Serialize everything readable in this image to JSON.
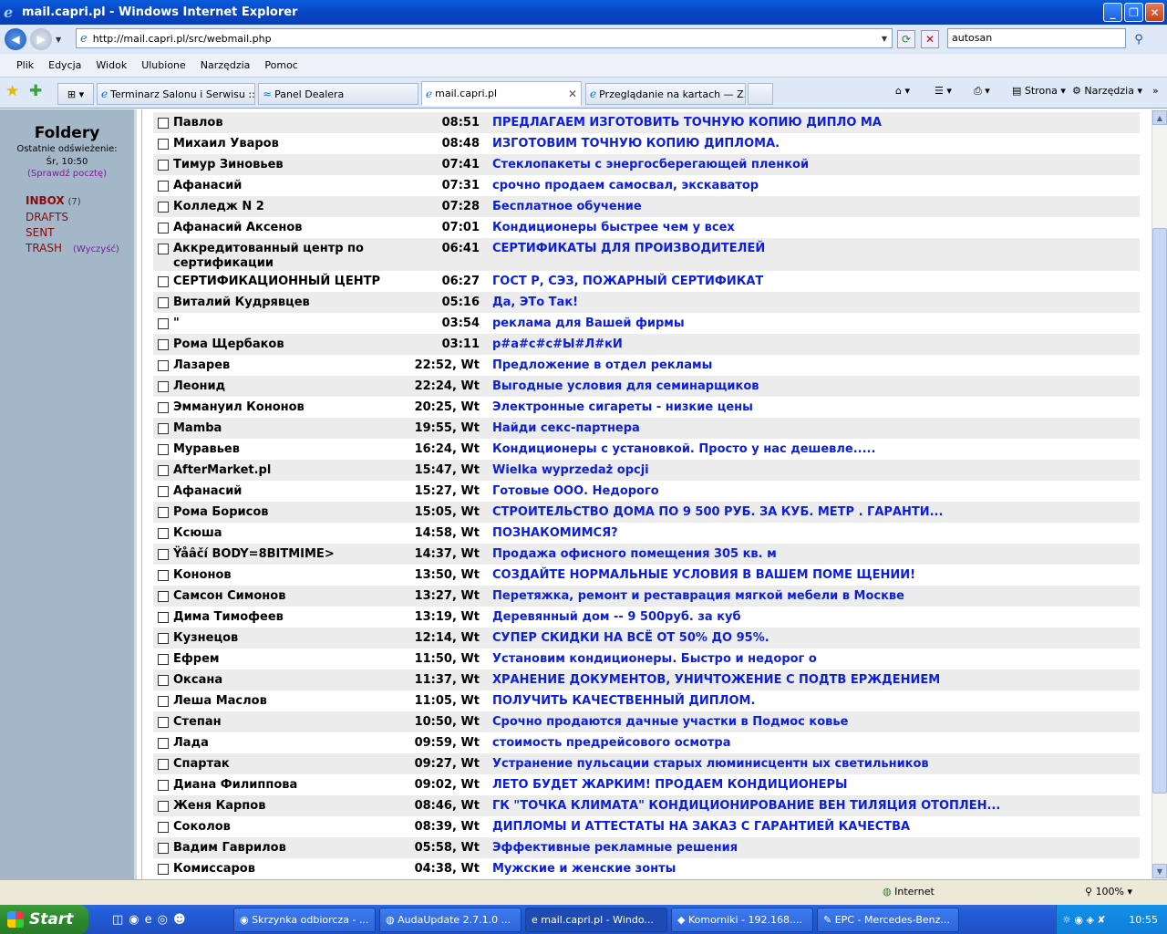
{
  "window": {
    "title": "mail.capri.pl - Windows Internet Explorer"
  },
  "address": {
    "url": "http://mail.capri.pl/src/webmail.php",
    "search": "autosan"
  },
  "menu": [
    "Plik",
    "Edycja",
    "Widok",
    "Ulubione",
    "Narzędzia",
    "Pomoc"
  ],
  "tabs": [
    {
      "label": "Terminarz Salonu i Serwisu ::..."
    },
    {
      "label": "Panel Dealera"
    },
    {
      "label": "mail.capri.pl"
    },
    {
      "label": "Przeglądanie na kartach — Z..."
    }
  ],
  "commands": {
    "page": "Strona",
    "tools": "Narzędzia"
  },
  "sidebar": {
    "title": "Foldery",
    "refresh_label": "Ostatnie odświeżenie:",
    "refresh_time": "Śr, 10:50",
    "check_mail": "(Sprawdź pocztę)",
    "folders": [
      {
        "name": "INBOX",
        "count": "(7)"
      },
      {
        "name": "DRAFTS"
      },
      {
        "name": "SENT"
      },
      {
        "name": "TRASH",
        "action": "(Wyczyść)"
      }
    ]
  },
  "messages": [
    {
      "from": "Павлов",
      "date": "08:51",
      "subject": "ПРЕДЛАГАЕМ ИЗГОТОВИТЬ ТОЧНУЮ КОПИЮ ДИПЛО МА"
    },
    {
      "from": "Михаил Уваров",
      "date": "08:48",
      "subject": "ИЗГОТОВИМ ТОЧНУЮ КОПИЮ ДИПЛОМА."
    },
    {
      "from": "Тимур Зиновьев",
      "date": "07:41",
      "subject": "Стеклопакеты с энергосберегающей пленкой"
    },
    {
      "from": "Афанасий",
      "date": "07:31",
      "subject": "срочно продаем самосвал, экскаватор"
    },
    {
      "from": "Колледж N 2",
      "date": "07:28",
      "subject": "Бесплатное обучение"
    },
    {
      "from": "Афанасий Аксенов",
      "date": "07:01",
      "subject": "Кондиционеры быстрее чем у всех"
    },
    {
      "from": "Аккредитованный центр по сертификации",
      "date": "06:41",
      "subject": "СЕРТИФИКАТЫ ДЛЯ ПРОИЗВОДИТЕЛЕЙ"
    },
    {
      "from": "СЕРТИФИКАЦИОННЫЙ ЦЕНТР",
      "date": "06:27",
      "subject": "ГОСТ Р, СЭЗ, ПОЖАРНЫЙ СЕРТИФИКАТ"
    },
    {
      "from": "Виталий Кудрявцев",
      "date": "05:16",
      "subject": "Да, ЭТо Так!"
    },
    {
      "from": "\"",
      "date": "03:54",
      "subject": "реклама для Вашей фирмы"
    },
    {
      "from": "Рома Щербаков",
      "date": "03:11",
      "subject": "р#а#с#с#Ы#Л#кИ"
    },
    {
      "from": "Лазарев",
      "date": "22:52, Wt",
      "subject": "Предложение в отдел рекламы"
    },
    {
      "from": "Леонид",
      "date": "22:24, Wt",
      "subject": "Выгодные условия для семинарщиков"
    },
    {
      "from": "Эммануил Кононов",
      "date": "20:25, Wt",
      "subject": "Электронные сигареты - низкие цены"
    },
    {
      "from": "Mamba",
      "date": "19:55, Wt",
      "subject": "Найди секс-партнера"
    },
    {
      "from": "Муравьев",
      "date": "16:24, Wt",
      "subject": "Кондиционеры с установкой. Просто у нас дешевле....."
    },
    {
      "from": "AfterMarket.pl",
      "date": "15:47, Wt",
      "subject": "Wielka wyprzedaż opcji"
    },
    {
      "from": "Афанасий",
      "date": "15:27, Wt",
      "subject": "Готовые ООО. Недорого"
    },
    {
      "from": "Рома Борисов",
      "date": "15:05, Wt",
      "subject": "СТРОИТЕЛЬСТВО ДОМА ПО 9 500 РУБ. ЗА КУБ. МЕТР . ГАРАНТИ..."
    },
    {
      "from": "Ксюша",
      "date": "14:58, Wt",
      "subject": "ПОЗНАКОМИМСЯ?"
    },
    {
      "from": "Ÿåâčí BODY=8BITMIME>",
      "date": "14:37, Wt",
      "subject": "Продажа офисного помещения 305 кв. м"
    },
    {
      "from": "Кононов",
      "date": "13:50, Wt",
      "subject": "СОЗДАЙТЕ НОРМАЛЬНЫЕ УСЛОВИЯ В ВАШЕМ ПОМЕ ЩЕНИИ!"
    },
    {
      "from": "Самсон Симонов",
      "date": "13:27, Wt",
      "subject": "Перетяжка, ремонт и реставрация мягкой мебели в Москве"
    },
    {
      "from": "Дима Тимофеев",
      "date": "13:19, Wt",
      "subject": "Деревянный дом -- 9 500руб. за куб"
    },
    {
      "from": "Кузнецов",
      "date": "12:14, Wt",
      "subject": "СУПЕР СКИДКИ НА ВСЁ ОТ 50% ДО 95%."
    },
    {
      "from": "Ефрем",
      "date": "11:50, Wt",
      "subject": "Установим кондиционеры. Быстро и недорог о"
    },
    {
      "from": "Оксана",
      "date": "11:37, Wt",
      "subject": "ХРАНЕНИЕ ДОКУМЕНТОВ, УНИЧТОЖЕНИЕ С ПОДТВ ЕРЖДЕНИЕМ"
    },
    {
      "from": "Леша Маслов",
      "date": "11:05, Wt",
      "subject": "ПОЛУЧИТЬ КАЧЕСТВЕННЫЙ ДИПЛОМ."
    },
    {
      "from": "Степан",
      "date": "10:50, Wt",
      "subject": "Срочно продаются дачные участки в Подмос ковье"
    },
    {
      "from": "Лада",
      "date": "09:59, Wt",
      "subject": "стоимость предрейсового осмотра"
    },
    {
      "from": "Спартак",
      "date": "09:27, Wt",
      "subject": "Устранение пульсации старых люминисцентн ых светильников"
    },
    {
      "from": "Диана Филиппова",
      "date": "09:02, Wt",
      "subject": "ЛЕТО БУДЕТ ЖАРКИМ! ПРОДАЕМ КОНДИЦИОНЕРЫ"
    },
    {
      "from": "Женя Карпов",
      "date": "08:46, Wt",
      "subject": "ГК \"ТОЧКА КЛИМАТА\" КОНДИЦИОНИРОВАНИЕ ВЕН ТИЛЯЦИЯ ОТОПЛЕН..."
    },
    {
      "from": "Соколов",
      "date": "08:39, Wt",
      "subject": "ДИПЛОМЫ И АТТЕСТАТЫ НА ЗАКАЗ С ГАРАНТИЕЙ КАЧЕСТВА"
    },
    {
      "from": "Вадим Гаврилов",
      "date": "05:58, Wt",
      "subject": "Эффективные рекламные решения"
    },
    {
      "from": "Комиссаров",
      "date": "04:38, Wt",
      "subject": "Мужские и женские зонты"
    }
  ],
  "status": {
    "zone": "Internet",
    "zoom": "100%"
  },
  "taskbar": {
    "start": "Start",
    "tasks": [
      {
        "label": "Skrzynka odbiorcza - ..."
      },
      {
        "label": "AudaUpdate 2.7.1.0 ..."
      },
      {
        "label": "mail.capri.pl - Windo..."
      },
      {
        "label": "Komorniki - 192.168...."
      },
      {
        "label": "EPC - Mercedes-Benz..."
      }
    ],
    "clock": "10:55"
  }
}
